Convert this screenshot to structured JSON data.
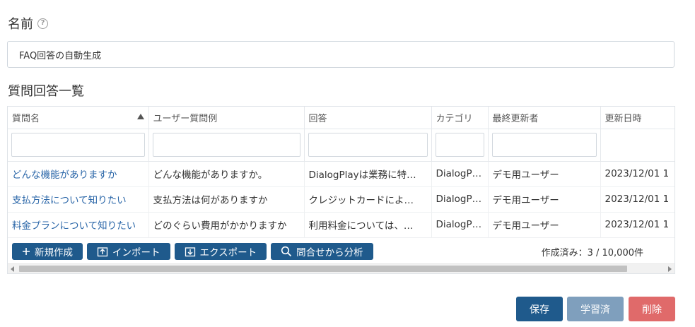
{
  "form": {
    "name_label": "名前",
    "help_glyph": "?",
    "name_value": "FAQ回答の自動生成"
  },
  "qa_list": {
    "title": "質問回答一覧",
    "columns": [
      "質問名",
      "ユーザー質問例",
      "回答",
      "カテゴリ",
      "最終更新者",
      "更新日時"
    ],
    "sort": {
      "column": "質問名",
      "direction": "ascending"
    },
    "rows": [
      [
        "どんな機能がありますか",
        "どんな機能がありますか。",
        "DialogPlayは業務に特…",
        "DialogP…",
        "デモ用ユーザー",
        "2023/12/01 1"
      ],
      [
        "支払方法について知りたい",
        "支払方法は何がありますか",
        "クレジットカードによ…",
        "DialogP…",
        "デモ用ユーザー",
        "2023/12/01 1"
      ],
      [
        "料金プランについて知りたい",
        "どのぐらい費用がかかりますか",
        "利用料金については、…",
        "DialogP…",
        "デモ用ユーザー",
        "2023/12/01 1"
      ]
    ],
    "toolbar": {
      "new_label": "新規作成",
      "import_label": "インポート",
      "export_label": "エクスポート",
      "analyze_label": "問合せから分析",
      "count_text": "作成済み：3 / 10,000件"
    }
  },
  "actions": {
    "save_label": "保存",
    "learned_label": "学習済",
    "delete_label": "削除"
  },
  "colors": {
    "primary": "#1f5a8c",
    "disabled": "#7f9fbd",
    "danger": "#e06a6a",
    "link": "#2a66a8"
  }
}
